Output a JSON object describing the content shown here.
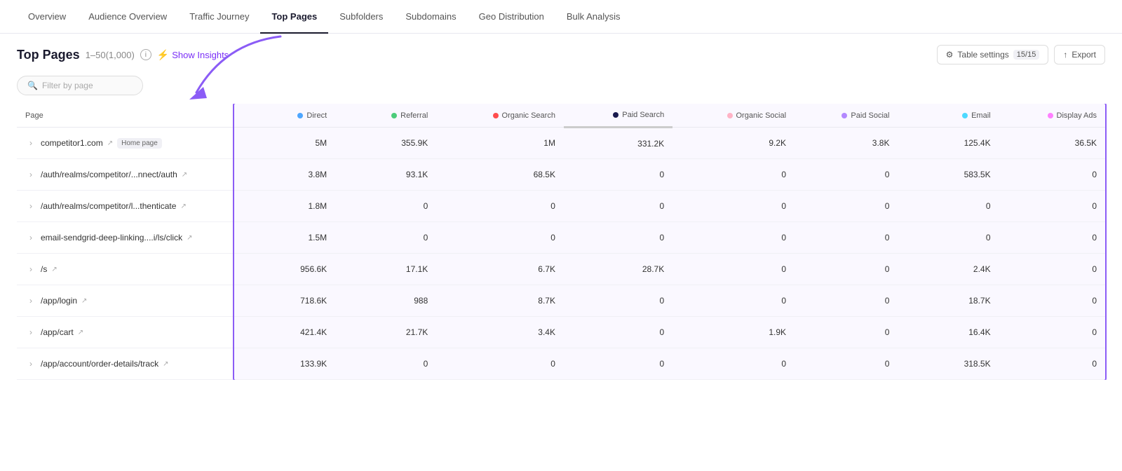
{
  "nav": {
    "items": [
      {
        "label": "Overview",
        "active": false
      },
      {
        "label": "Audience Overview",
        "active": false
      },
      {
        "label": "Traffic Journey",
        "active": false
      },
      {
        "label": "Top Pages",
        "active": true
      },
      {
        "label": "Subfolders",
        "active": false
      },
      {
        "label": "Subdomains",
        "active": false
      },
      {
        "label": "Geo Distribution",
        "active": false
      },
      {
        "label": "Bulk Analysis",
        "active": false
      }
    ]
  },
  "header": {
    "title": "Top Pages",
    "range": "1–50(1,000)",
    "info_label": "i",
    "show_insights": "Show Insights",
    "table_settings": "Table settings",
    "badge": "15/15",
    "export": "Export"
  },
  "filter": {
    "placeholder": "Filter by page"
  },
  "columns": {
    "page": "Page",
    "channels": [
      {
        "label": "Direct",
        "color": "#4da6ff"
      },
      {
        "label": "Referral",
        "color": "#4ccc7a"
      },
      {
        "label": "Organic Search",
        "color": "#ff4d4d"
      },
      {
        "label": "Paid Search",
        "color": "#1a1a4e"
      },
      {
        "label": "Organic Social",
        "color": "#ffb3c6"
      },
      {
        "label": "Paid Social",
        "color": "#b388ff"
      },
      {
        "label": "Email",
        "color": "#4dd9ff"
      },
      {
        "label": "Display Ads",
        "color": "#ff80ff"
      }
    ]
  },
  "rows": [
    {
      "page": "competitor1.com",
      "is_domain": true,
      "badge": "Home page",
      "external": true,
      "values": [
        "5M",
        "355.9K",
        "1M",
        "331.2K",
        "9.2K",
        "3.8K",
        "125.4K",
        "36.5K"
      ]
    },
    {
      "page": "/auth/realms/competitor/...nnect/auth",
      "external": true,
      "values": [
        "3.8M",
        "93.1K",
        "68.5K",
        "0",
        "0",
        "0",
        "583.5K",
        "0"
      ]
    },
    {
      "page": "/auth/realms/competitor/l...thenticate",
      "external": true,
      "values": [
        "1.8M",
        "0",
        "0",
        "0",
        "0",
        "0",
        "0",
        "0"
      ]
    },
    {
      "page": "email-sendgrid-deep-linking....i/ls/click",
      "external": true,
      "values": [
        "1.5M",
        "0",
        "0",
        "0",
        "0",
        "0",
        "0",
        "0"
      ]
    },
    {
      "page": "/s",
      "external": true,
      "values": [
        "956.6K",
        "17.1K",
        "6.7K",
        "28.7K",
        "0",
        "0",
        "2.4K",
        "0"
      ]
    },
    {
      "page": "/app/login",
      "external": true,
      "values": [
        "718.6K",
        "988",
        "8.7K",
        "0",
        "0",
        "0",
        "18.7K",
        "0"
      ]
    },
    {
      "page": "/app/cart",
      "external": true,
      "values": [
        "421.4K",
        "21.7K",
        "3.4K",
        "0",
        "1.9K",
        "0",
        "16.4K",
        "0"
      ]
    },
    {
      "page": "/app/account/order-details/track",
      "external": true,
      "values": [
        "133.9K",
        "0",
        "0",
        "0",
        "0",
        "0",
        "318.5K",
        "0"
      ]
    }
  ]
}
